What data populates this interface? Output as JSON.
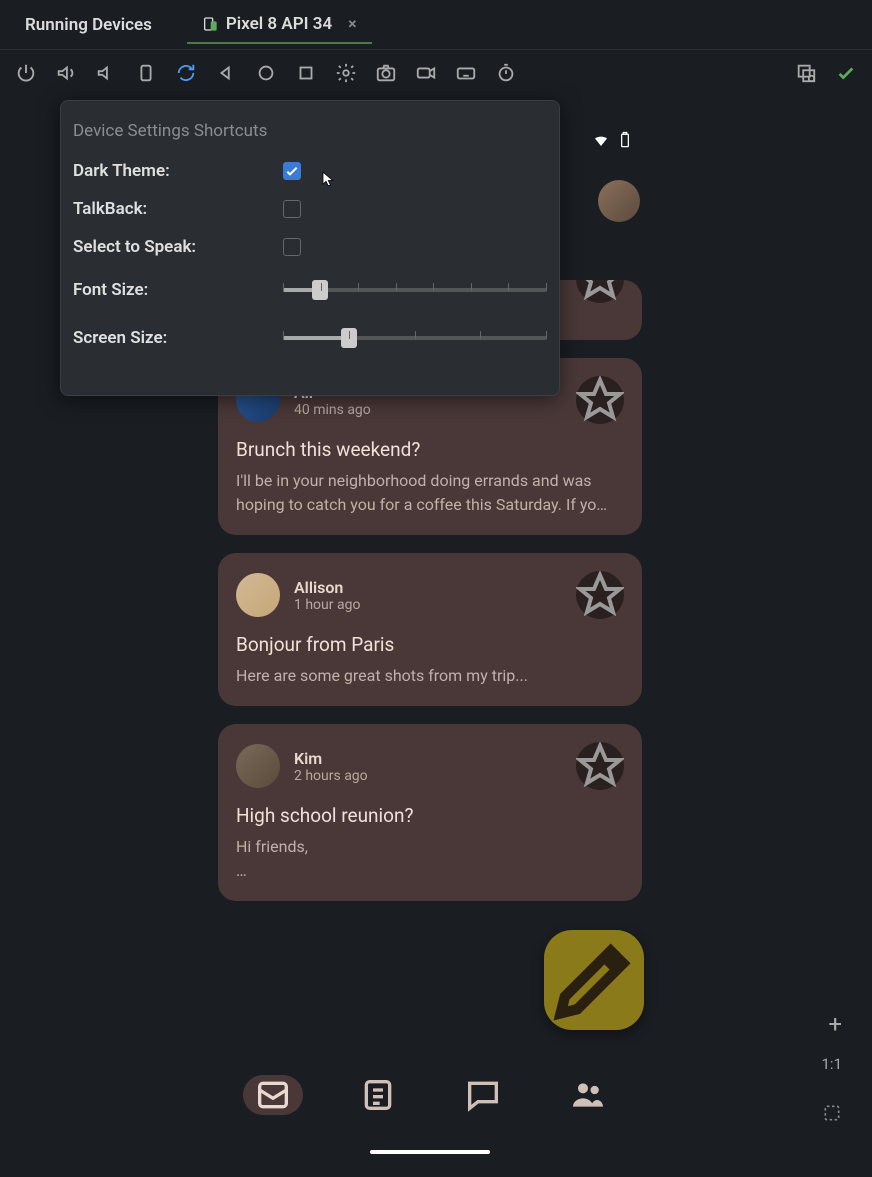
{
  "tabs": {
    "running": "Running Devices",
    "device": "Pixel 8 API 34"
  },
  "settings": {
    "title": "Device Settings Shortcuts",
    "dark_theme_label": "Dark Theme:",
    "dark_theme_checked": true,
    "talkback_label": "TalkBack:",
    "talkback_checked": false,
    "select_speak_label": "Select to Speak:",
    "select_speak_checked": false,
    "font_size_label": "Font Size:",
    "font_size_percent": 14,
    "screen_size_label": "Screen Size:",
    "screen_size_percent": 25
  },
  "emails": [
    {
      "sender": "",
      "time": "",
      "subject": "",
      "body": "…",
      "partial": true
    },
    {
      "sender": "Ali",
      "time": "40 mins ago",
      "subject": "Brunch this weekend?",
      "body": "I'll be in your neighborhood doing errands and was hoping to catch you for a coffee this Saturday. If yo…"
    },
    {
      "sender": "Allison",
      "time": "1 hour ago",
      "subject": "Bonjour from Paris",
      "body": "Here are some great shots from my trip..."
    },
    {
      "sender": "Kim",
      "time": "2 hours ago",
      "subject": "High school reunion?",
      "body": "Hi friends,\n…"
    }
  ],
  "right_controls": {
    "ratio": "1:1"
  }
}
